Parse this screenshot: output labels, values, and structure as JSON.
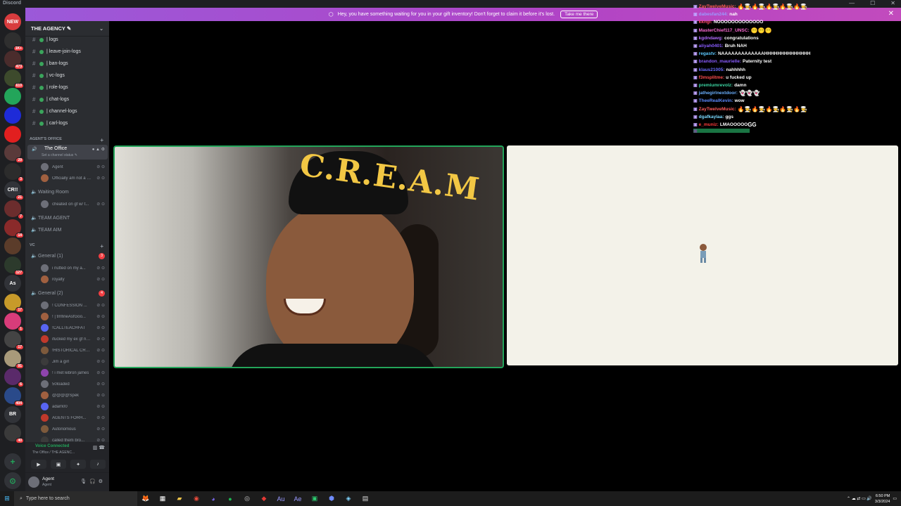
{
  "window": {
    "app_name": "Discord"
  },
  "banner": {
    "text": "Hey, you have something waiting for you in your gift inventory! Don't forget to claim it before it's lost.",
    "button": "Take me there"
  },
  "rail": {
    "servers": [
      {
        "label": "NEW",
        "color": "#d83c3e",
        "badge": ""
      },
      {
        "label": "",
        "color": "#2f2f2f",
        "badge": "1K+"
      },
      {
        "label": "",
        "color": "#4a2c2c",
        "badge": "473"
      },
      {
        "label": "",
        "color": "#3d4a2c",
        "badge": "610"
      },
      {
        "label": "",
        "color": "#23a55a",
        "badge": ""
      },
      {
        "label": "",
        "color": "#1e2bd8",
        "badge": ""
      },
      {
        "label": "",
        "color": "#e21f1f",
        "badge": ""
      },
      {
        "label": "",
        "color": "#5a3a3a",
        "badge": "29"
      },
      {
        "label": "",
        "color": "#2c2c2c",
        "badge": "3"
      },
      {
        "label": "CR!!",
        "color": "#313338",
        "badge": "21"
      },
      {
        "label": "",
        "color": "#6b2d2d",
        "badge": "7"
      },
      {
        "label": "",
        "color": "#8a2a2a",
        "badge": "14"
      },
      {
        "label": "",
        "color": "#5b3c2a",
        "badge": ""
      },
      {
        "label": "",
        "color": "#2c3a2c",
        "badge": "127"
      },
      {
        "label": "As",
        "color": "#313338",
        "badge": ""
      },
      {
        "label": "",
        "color": "#c79a2a",
        "badge": "17"
      },
      {
        "label": "",
        "color": "#d83c7a",
        "badge": "1"
      },
      {
        "label": "",
        "color": "#444",
        "badge": "17"
      },
      {
        "label": "",
        "color": "#a89a7a",
        "badge": "91"
      },
      {
        "label": "",
        "color": "#5a2a6a",
        "badge": "6"
      },
      {
        "label": "",
        "color": "#2a4a8a",
        "badge": "404"
      },
      {
        "label": "BR",
        "color": "#313338",
        "badge": ""
      },
      {
        "label": "",
        "color": "#3a3a3a",
        "badge": "40"
      }
    ],
    "add_label": "+",
    "explore_label": "⊙"
  },
  "guild": {
    "name": "THE AGENCY ✎",
    "text_channels": [
      "| logs",
      "| leave-join-logs",
      "| ban-logs",
      "| vc-logs",
      "| role-logs",
      "| chat-logs",
      "| channel-logs",
      "| carl-logs"
    ],
    "category_office": "AGENT'S OFFICE",
    "office": {
      "name": "The Office",
      "status": "Set a channel status ✎"
    },
    "office_members": [
      "Agent",
      "Officially am not a cuck"
    ],
    "waiting_room": "Waiting Room",
    "waiting_members": [
      "cheated on gf w/ t..."
    ],
    "team_channels": [
      "TEAM AGENT",
      "TEAM AIM"
    ],
    "category_vc": "VC",
    "general1": {
      "name": "General (1)",
      "count": "3"
    },
    "general1_members": [
      "i nutted on my a...",
      "royalty"
    ],
    "general2": {
      "name": "General (2)",
      "count": "4"
    },
    "general2_members": [
      "! CONFESSION ...",
      "! | tmfineAsfGoo...",
      "!CALLTEACHFAT",
      "ifucked my ex gf ne...",
      "!HISTORICAL CRAS...",
      "Jim a girl",
      "! i met lebron james",
      "50loaded",
      "@@@@Spek",
      "adam00",
      "AGENTS FORH...",
      "Autonomous",
      "called them bro..."
    ]
  },
  "voice_panel": {
    "status": "Voice Connected",
    "channel": "The Office / THE AGENC..."
  },
  "user_panel": {
    "name": "Agent",
    "status": "Agent"
  },
  "chat": {
    "messages": [
      {
        "user": "ZayTwelveMusic:",
        "color": "#ff5a5a",
        "text": "",
        "emotes": "🔥🧑‍🍳🔥🧑‍🍳🔥🧑‍🍳🔥🧑‍🍳🔥🧑‍🍳"
      },
      {
        "user": "dabesfan244:",
        "color": "#9b9bff",
        "text": "nah",
        "emotes": ""
      },
      {
        "user": "kkngi:",
        "color": "#ff4d6d",
        "text": "NOOOOOOOOOOOOO",
        "emotes": ""
      },
      {
        "user": "MasterChief117_UNSC:",
        "color": "#ff6bd6",
        "text": "",
        "emotes": "😶😶😶"
      },
      {
        "user": "kgdndawg:",
        "color": "#b26bff",
        "text": "congratulations",
        "emotes": ""
      },
      {
        "user": "aliyah0401:",
        "color": "#8a5cff",
        "text": "Bruh NAH",
        "emotes": ""
      },
      {
        "user": "regastv:",
        "color": "#5cc8ff",
        "text": "NAAAAAAAAAAAAAHHHHHHHHHHHHHH",
        "emotes": ""
      },
      {
        "user": "brandon_maurielle:",
        "color": "#8a5cff",
        "text": "Paternity test",
        "emotes": ""
      },
      {
        "user": "klaus21005:",
        "color": "#6b6bff",
        "text": "nahhhhh",
        "emotes": ""
      },
      {
        "user": "f3msplitme:",
        "color": "#ff4d4d",
        "text": "u fucked up",
        "emotes": ""
      },
      {
        "user": "premiumrevolz:",
        "color": "#3bd6a3",
        "text": "damn",
        "emotes": ""
      },
      {
        "user": "jathegirlnextdoor:",
        "color": "#6bb0ff",
        "text": "",
        "emotes": "👻👻👻"
      },
      {
        "user": "TheeRealKevin:",
        "color": "#5c8aff",
        "text": "wow",
        "emotes": ""
      },
      {
        "user": "ZayTwelveMusic:",
        "color": "#ff5a5a",
        "text": "",
        "emotes": "🔥🧑‍🍳🔥🧑‍🍳🔥🧑‍🍳🔥🧑‍🍳🔥🧑‍🍳"
      },
      {
        "user": "dgafkaylaa:",
        "color": "#7ad9ff",
        "text": "ggs",
        "emotes": ""
      },
      {
        "user": "e_muniz:",
        "color": "#ff3b3b",
        "text": "LMAOOOOO",
        "emotes": "GG"
      },
      {
        "user": "",
        "color": "#2fd37a",
        "text": "",
        "emotes": ""
      }
    ]
  },
  "taskbar": {
    "search_placeholder": "Type here to search",
    "time": "6:50 PM",
    "date": "3/3/2024"
  }
}
